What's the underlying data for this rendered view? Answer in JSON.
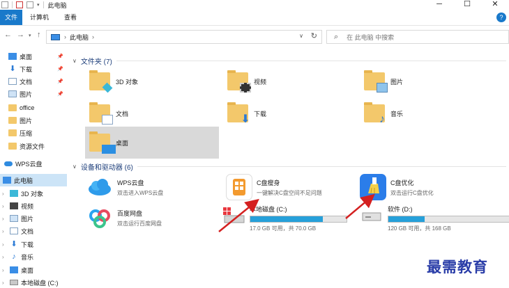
{
  "window": {
    "title": "此电脑",
    "controls": [
      "─",
      "☐",
      "✕"
    ]
  },
  "ribbon": {
    "tabs": [
      "文件",
      "计算机",
      "查看"
    ],
    "help_label": "?"
  },
  "address": {
    "crumbs": [
      "此电脑"
    ],
    "search_placeholder": "在 此电脑 中搜索"
  },
  "sidebar": {
    "items": [
      {
        "label": "桌面",
        "icon": "desktop-icon",
        "pinned": true
      },
      {
        "label": "下载",
        "icon": "download-icon",
        "pinned": true
      },
      {
        "label": "文档",
        "icon": "document-icon",
        "pinned": true
      },
      {
        "label": "图片",
        "icon": "pictures-icon",
        "pinned": true
      },
      {
        "label": "office",
        "icon": "folder-icon",
        "pinned": false
      },
      {
        "label": "图片",
        "icon": "folder-icon",
        "pinned": false
      },
      {
        "label": "压缩",
        "icon": "folder-icon",
        "pinned": false
      },
      {
        "label": "资源文件",
        "icon": "folder-icon",
        "pinned": false
      },
      {
        "label": "WPS云盘",
        "icon": "cloud-icon",
        "pinned": false
      },
      {
        "label": "此电脑",
        "icon": "computer-icon",
        "pinned": false,
        "selected": true
      },
      {
        "label": "3D 对象",
        "icon": "3d-objects-icon",
        "pinned": false
      },
      {
        "label": "视频",
        "icon": "video-icon",
        "pinned": false
      },
      {
        "label": "图片",
        "icon": "pictures-icon",
        "pinned": false
      },
      {
        "label": "文档",
        "icon": "document-icon",
        "pinned": false
      },
      {
        "label": "下载",
        "icon": "download-icon",
        "pinned": false
      },
      {
        "label": "音乐",
        "icon": "music-icon",
        "pinned": false
      },
      {
        "label": "桌面",
        "icon": "desktop-icon",
        "pinned": false
      },
      {
        "label": "本地磁盘 (C:)",
        "icon": "drive-icon",
        "pinned": false
      }
    ]
  },
  "folders": {
    "header": "文件夹 (7)",
    "items": [
      {
        "label": "3D 对象",
        "icon": "3d-objects-icon"
      },
      {
        "label": "视频",
        "icon": "video-icon"
      },
      {
        "label": "图片",
        "icon": "pictures-icon"
      },
      {
        "label": "文档",
        "icon": "document-icon"
      },
      {
        "label": "下载",
        "icon": "download-icon"
      },
      {
        "label": "音乐",
        "icon": "music-icon"
      },
      {
        "label": "桌面",
        "icon": "desktop-icon",
        "selected": true
      }
    ]
  },
  "devices": {
    "header": "设备和驱动器 (6)",
    "apps": [
      {
        "name": "WPS云盘",
        "desc": "双击进入WPS云盘",
        "icon": "wps-cloud-icon"
      },
      {
        "name": "C盘瘦身",
        "desc": "一键解决C盘空间不足问题",
        "icon": "c-drive-slim-icon"
      },
      {
        "name": "C盘优化",
        "desc": "双击运行C盘优化",
        "icon": "c-drive-optimize-icon"
      },
      {
        "name": "百度网盘",
        "desc": "双击运行百度网盘",
        "icon": "baidu-netdisk-icon"
      }
    ],
    "drives": [
      {
        "name": "本地磁盘 (C:)",
        "space": "17.0 GB 可用，共 70.0 GB",
        "used_fraction": 0.757,
        "icon": "windows-drive-icon"
      },
      {
        "name": "软件 (D:)",
        "space": "120 GB 可用，共 168 GB",
        "used_fraction": 0.286,
        "icon": "drive-icon"
      }
    ]
  },
  "watermark": "最需教育",
  "colors": {
    "accent": "#1979ca",
    "selection": "#cce4f7",
    "drive_bar": "#26a0da",
    "annotation_arrow": "#d42020"
  }
}
